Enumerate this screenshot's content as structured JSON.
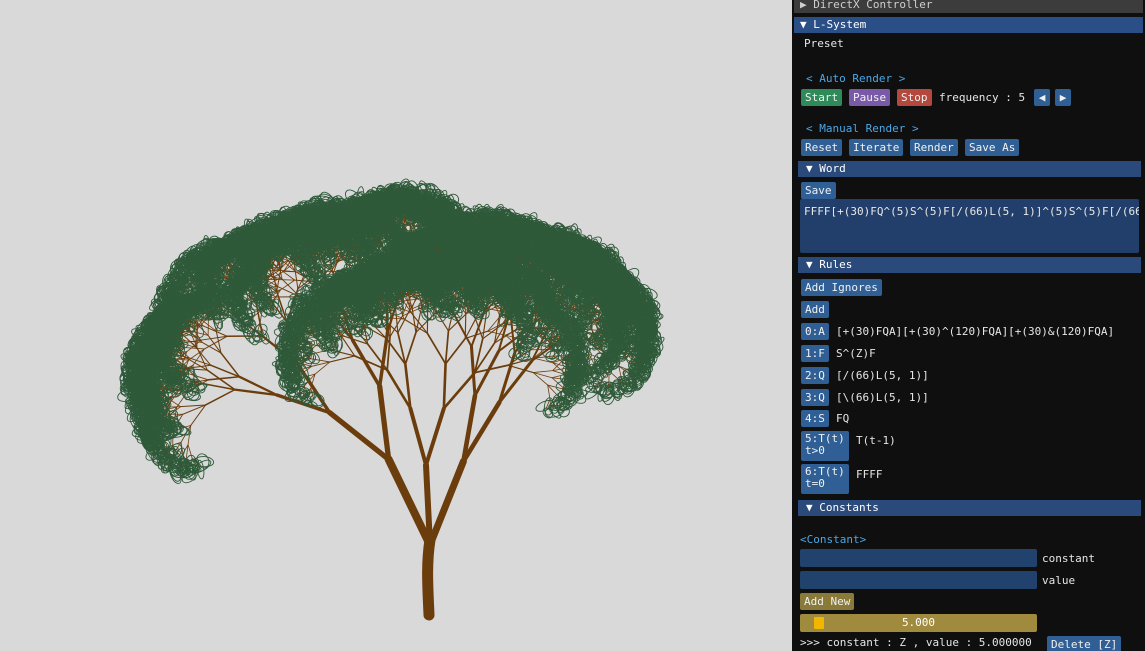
{
  "panel": {
    "directx_header": "▶ DirectX Controller",
    "lsystem_header": "▼ L-System",
    "preset_label": "Preset",
    "auto_render": {
      "title": "< Auto Render >",
      "start": "Start",
      "pause": "Pause",
      "stop": "Stop",
      "frequency_label": "frequency : 5",
      "dec_arrow": "◀",
      "inc_arrow": "▶"
    },
    "manual_render": {
      "title": "< Manual Render >",
      "reset": "Reset",
      "iterate": "Iterate",
      "render": "Render",
      "save_as": "Save As"
    },
    "word": {
      "header": "▼  Word",
      "save": "Save",
      "value": "FFFF[+(30)FQ^(5)S^(5)F[/(66)L(5, 1)]^(5)S^(5)F[/(66"
    },
    "rules": {
      "header": "▼  Rules",
      "add_ignores": "Add Ignores",
      "add": "Add",
      "items": [
        {
          "key": "0:A",
          "value": "[+(30)FQA][+(30)^(120)FQA][+(30)&(120)FQA]"
        },
        {
          "key": "1:F",
          "value": "S^(Z)F"
        },
        {
          "key": "2:Q",
          "value": "[/(66)L(5, 1)]"
        },
        {
          "key": "3:Q",
          "value": "[\\(66)L(5, 1)]"
        },
        {
          "key": "4:S",
          "value": "FQ"
        },
        {
          "key": "5:T(t)",
          "cond": "t>0",
          "value": "T(t-1)"
        },
        {
          "key": "6:T(t)",
          "cond": "t=0",
          "value": "FFFF"
        }
      ]
    },
    "constants": {
      "header": "▼  Constants",
      "section_title": "<Constant>",
      "constant_label": "constant",
      "value_label": "value",
      "add_new": "Add New",
      "slider_value": "5.000",
      "list_entry": ">>> constant : Z  , value : 5.000000",
      "delete": "Delete [Z]"
    }
  },
  "colors": {
    "branch": "#6b3d0c",
    "leaf": "#2f5a3a"
  }
}
